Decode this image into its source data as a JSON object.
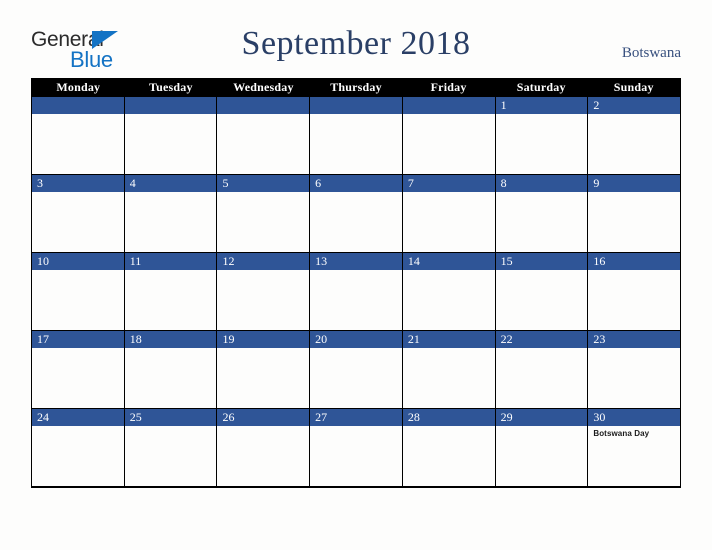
{
  "brand": {
    "name_top": "General",
    "name_bottom": "Blue",
    "triangle_color": "#1473c4",
    "top_color": "#2b2b2b"
  },
  "header": {
    "title": "September 2018",
    "country": "Botswana",
    "title_color": "#2a3f66"
  },
  "theme": {
    "date_bar_color": "#2f5597",
    "dow_header_bg": "#000000",
    "dow_header_text": "#ffffff",
    "page_background": "#fdfdfc",
    "grid_line": "#000000"
  },
  "calendar": {
    "day_names": [
      "Monday",
      "Tuesday",
      "Wednesday",
      "Thursday",
      "Friday",
      "Saturday",
      "Sunday"
    ],
    "weeks": [
      [
        {
          "date": "",
          "events": []
        },
        {
          "date": "",
          "events": []
        },
        {
          "date": "",
          "events": []
        },
        {
          "date": "",
          "events": []
        },
        {
          "date": "",
          "events": []
        },
        {
          "date": "1",
          "events": []
        },
        {
          "date": "2",
          "events": []
        }
      ],
      [
        {
          "date": "3",
          "events": []
        },
        {
          "date": "4",
          "events": []
        },
        {
          "date": "5",
          "events": []
        },
        {
          "date": "6",
          "events": []
        },
        {
          "date": "7",
          "events": []
        },
        {
          "date": "8",
          "events": []
        },
        {
          "date": "9",
          "events": []
        }
      ],
      [
        {
          "date": "10",
          "events": []
        },
        {
          "date": "11",
          "events": []
        },
        {
          "date": "12",
          "events": []
        },
        {
          "date": "13",
          "events": []
        },
        {
          "date": "14",
          "events": []
        },
        {
          "date": "15",
          "events": []
        },
        {
          "date": "16",
          "events": []
        }
      ],
      [
        {
          "date": "17",
          "events": []
        },
        {
          "date": "18",
          "events": []
        },
        {
          "date": "19",
          "events": []
        },
        {
          "date": "20",
          "events": []
        },
        {
          "date": "21",
          "events": []
        },
        {
          "date": "22",
          "events": []
        },
        {
          "date": "23",
          "events": []
        }
      ],
      [
        {
          "date": "24",
          "events": []
        },
        {
          "date": "25",
          "events": []
        },
        {
          "date": "26",
          "events": []
        },
        {
          "date": "27",
          "events": []
        },
        {
          "date": "28",
          "events": []
        },
        {
          "date": "29",
          "events": []
        },
        {
          "date": "30",
          "events": [
            "Botswana Day"
          ]
        }
      ]
    ]
  }
}
